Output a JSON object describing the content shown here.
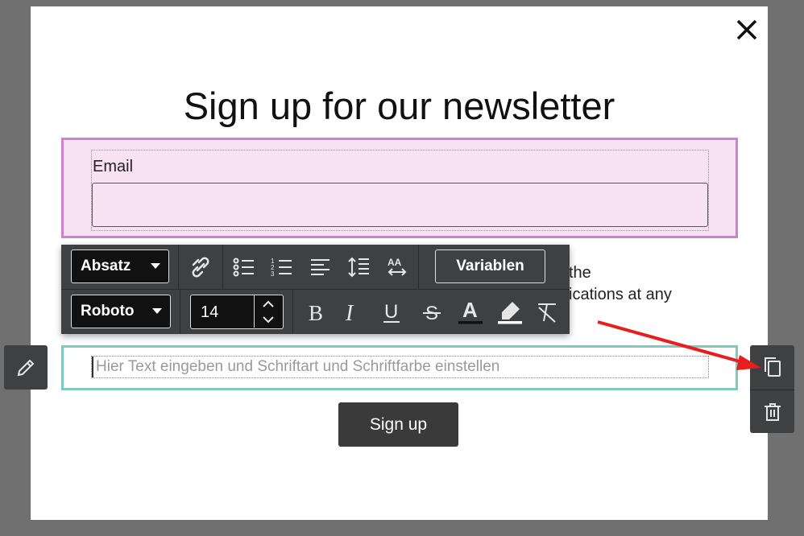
{
  "modal": {
    "title": "Sign up for our newsletter",
    "email_label": "Email",
    "consent_line1": "the",
    "consent_line2": "ications at any",
    "text_placeholder": "Hier Text eingeben und Schriftart und Schriftfarbe einstellen",
    "signup_label": "Sign up"
  },
  "toolbar": {
    "paragraph_select": "Absatz",
    "font_select": "Roboto",
    "font_size": "14",
    "variables_label": "Variablen",
    "icons": [
      "unlink-icon",
      "bullet-list-icon",
      "numbered-list-icon",
      "align-left-icon",
      "line-height-icon",
      "letter-spacing-icon",
      "bold-icon",
      "italic-icon",
      "underline-icon",
      "strikethrough-icon",
      "text-color-icon",
      "highlight-icon",
      "clear-format-icon"
    ]
  },
  "colors": {
    "email_block_border": "#d080d0",
    "email_block_bg": "#f7e2f3",
    "text_block_border": "#7ecbbd",
    "toolbar_bg": "#3f4042",
    "arrow": "#e81e1e"
  }
}
